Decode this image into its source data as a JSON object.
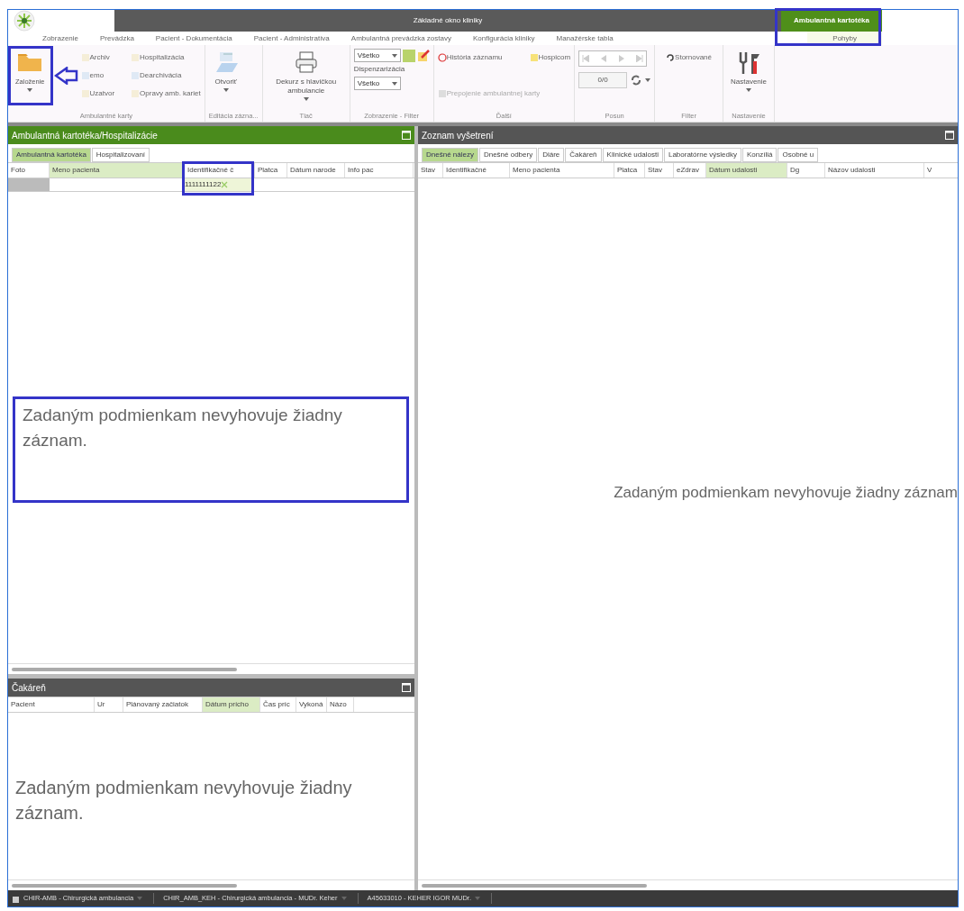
{
  "window": {
    "title": "Základné okno kliniky",
    "context_group": "Ambulantná kartotéka"
  },
  "ribbon_tabs": [
    {
      "label": "Zobrazenie",
      "selected": false
    },
    {
      "label": "Prevádzka",
      "selected": false
    },
    {
      "label": "Pacient - Dokumentácia",
      "selected": false
    },
    {
      "label": "Pacient - Administratíva",
      "selected": false
    },
    {
      "label": "Ambulantná prevádzka zostavy",
      "selected": false
    },
    {
      "label": "Konfigurácia kliniky",
      "selected": false
    },
    {
      "label": "Manažérske tabla",
      "selected": false
    },
    {
      "label": "Pohyby",
      "selected": true
    }
  ],
  "ribbon_groups": [
    {
      "kind": "cards",
      "label": "Ambulantné karty",
      "items": [
        {
          "kind": "big",
          "label": "Založenie"
        },
        {
          "kind": "small",
          "label": "Archiv"
        },
        {
          "kind": "small",
          "label": "emo"
        },
        {
          "kind": "small",
          "label": "Uzatvor"
        },
        {
          "kind": "small",
          "label": "Hospitalizácia"
        },
        {
          "kind": "small",
          "label": "Dearchivácia"
        },
        {
          "kind": "small",
          "label": "Opravy amb. kariet"
        }
      ]
    },
    {
      "kind": "single",
      "label": "Editácia zázna...",
      "items": [
        {
          "kind": "big",
          "label": "Otvoriť"
        }
      ]
    },
    {
      "kind": "single",
      "label": "Tlač",
      "items": [
        {
          "kind": "big",
          "label": "Dekurz s hlavičkou ambulancie"
        }
      ]
    },
    {
      "kind": "filter",
      "label": "Zobrazenie - Filter",
      "items": [
        {
          "kind": "dropdown",
          "value": "Všetko"
        },
        {
          "kind": "caption",
          "label": "Dispenzarizácia"
        },
        {
          "kind": "dropdown",
          "value": "Všetko"
        }
      ]
    },
    {
      "kind": "misc",
      "label": "Ďalší",
      "items": [
        {
          "kind": "small",
          "label": "História záznamu"
        },
        {
          "kind": "small",
          "label": "Prepojenie ambulantnej karty"
        },
        {
          "kind": "small",
          "label": "Hospicom"
        }
      ]
    },
    {
      "kind": "nav",
      "label": "Posun",
      "items": [
        {
          "kind": "counter",
          "value": "0/0"
        }
      ]
    },
    {
      "kind": "single",
      "label": "Filter",
      "items": [
        {
          "kind": "small",
          "label": "Stornované"
        }
      ]
    },
    {
      "kind": "single",
      "label": "Nastavenie",
      "items": [
        {
          "kind": "big",
          "label": "Nastavenie"
        }
      ]
    }
  ],
  "left_panel": {
    "title": "Ambulantná kartotéka/Hospitalizácie",
    "tabs": [
      {
        "label": "Ambulantná kartotéka",
        "selected": true
      },
      {
        "label": "Hospitalizovaní",
        "selected": false
      }
    ],
    "columns": [
      {
        "label": "Foto",
        "sorted": false
      },
      {
        "label": "Meno pacienta",
        "sorted": true
      },
      {
        "label": "Identifikačné č",
        "sorted": false
      },
      {
        "label": "Platca",
        "sorted": false
      },
      {
        "label": "Dátum narode",
        "sorted": false
      },
      {
        "label": "Info pac",
        "sorted": false
      }
    ],
    "filter_value": "1111111122",
    "empty_message": "Zadaným podmienkam nevyhovuje žiadny záznam."
  },
  "waiting_panel": {
    "title": "Čakáreň",
    "columns": [
      {
        "label": "Pacient",
        "sorted": false
      },
      {
        "label": "Ur",
        "sorted": false
      },
      {
        "label": "Plánovaný začiatok",
        "sorted": false
      },
      {
        "label": "Dátum prícho",
        "sorted": true
      },
      {
        "label": "Čas príc",
        "sorted": false
      },
      {
        "label": "Vykoná",
        "sorted": false
      },
      {
        "label": "Názo",
        "sorted": false
      }
    ],
    "empty_message": "Zadaným podmienkam nevyhovuje žiadny záznam."
  },
  "right_panel": {
    "title": "Zoznam vyšetrení",
    "tabs": [
      {
        "label": "Dnešné nálezy",
        "selected": true
      },
      {
        "label": "Dnešné odbery",
        "selected": false
      },
      {
        "label": "Diáre",
        "selected": false
      },
      {
        "label": "Čakáreň",
        "selected": false
      },
      {
        "label": "Klinické udalosti",
        "selected": false
      },
      {
        "label": "Laboratórne výsledky",
        "selected": false
      },
      {
        "label": "Konzíliá",
        "selected": false
      },
      {
        "label": "Osobné u",
        "selected": false
      }
    ],
    "columns": [
      {
        "label": "Stav",
        "sorted": false
      },
      {
        "label": "Identifikačné",
        "sorted": false
      },
      {
        "label": "Meno pacienta",
        "sorted": false
      },
      {
        "label": "Platca",
        "sorted": false
      },
      {
        "label": "Stav",
        "sorted": false
      },
      {
        "label": "eZdrav",
        "sorted": false
      },
      {
        "label": "Dátum udalosti",
        "sorted": true
      },
      {
        "label": "Dg",
        "sorted": false
      },
      {
        "label": "Názov udalosti",
        "sorted": false
      },
      {
        "label": "V",
        "sorted": false
      }
    ],
    "empty_message": "Zadaným podmienkam nevyhovuje žiadny záznam"
  },
  "status_bar": [
    {
      "label": "CHIR-AMB - Chirurgická ambulancia"
    },
    {
      "label": "CHIR_AMB_KEH - Chirurgická ambulancia - MUDr. Keher"
    },
    {
      "label": "A45633010 - KEHER IGOR MUDr."
    }
  ]
}
